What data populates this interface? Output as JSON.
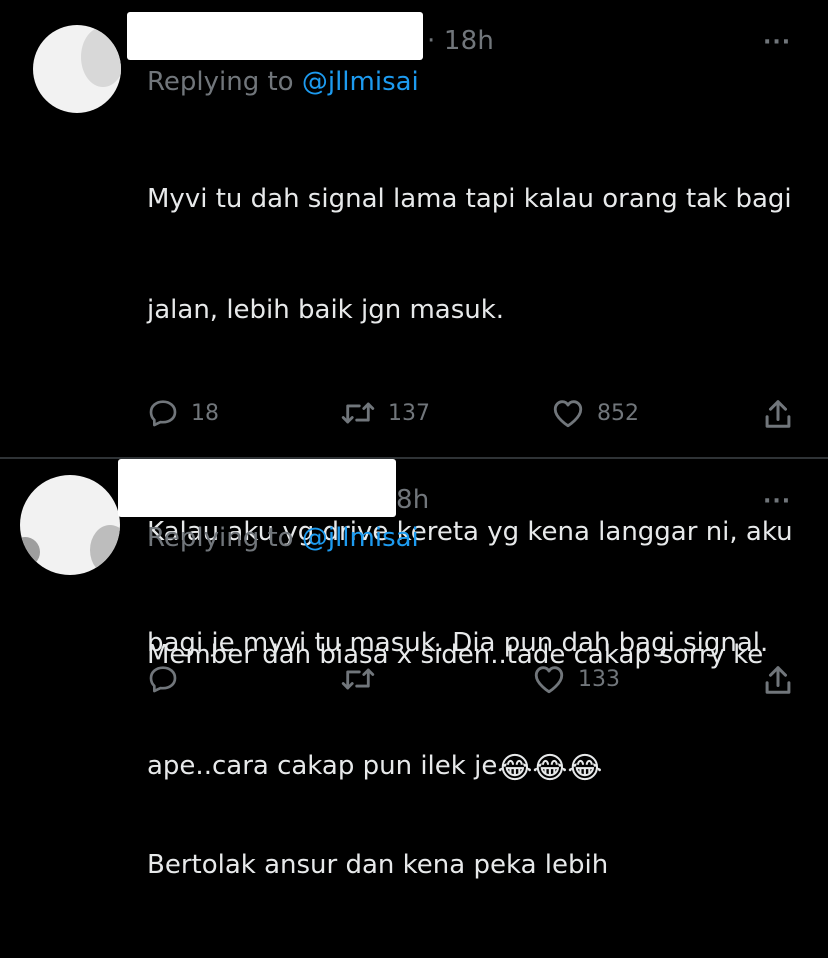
{
  "tweets": [
    {
      "time": "· 18h",
      "more": "···",
      "reply_prefix": "Replying to ",
      "reply_handle": "@jllmisai",
      "body_lines": [
        "Myvi tu dah signal lama tapi kalau orang tak bagi",
        "jalan, lebih baik jgn masuk.",
        "",
        "Kalau aku yg drive kereta yg kena langgar ni, aku",
        "bagi je myvi tu masuk. Dia pun dah bagi signal.",
        "",
        "Bertolak ansur dan kena peka lebih"
      ],
      "replies": "18",
      "retweets": "137",
      "likes": "852"
    },
    {
      "time": "8h",
      "more": "···",
      "reply_prefix": "Replying to ",
      "reply_handle": "@jllmisai",
      "body_line1": "Member dah biasa x siden..tade cakap sorry ke",
      "body_line2": "ape..cara cakap pun ilek je",
      "emojis": "😂😂😂",
      "replies": "",
      "retweets": "",
      "likes": "133"
    }
  ],
  "colors": {
    "muted": "#71767b",
    "link": "#1d9bf0",
    "text": "#e7e9ea",
    "divider": "#2f3336"
  },
  "icons": [
    "reply-icon",
    "retweet-icon",
    "like-icon",
    "share-icon",
    "more-icon"
  ]
}
